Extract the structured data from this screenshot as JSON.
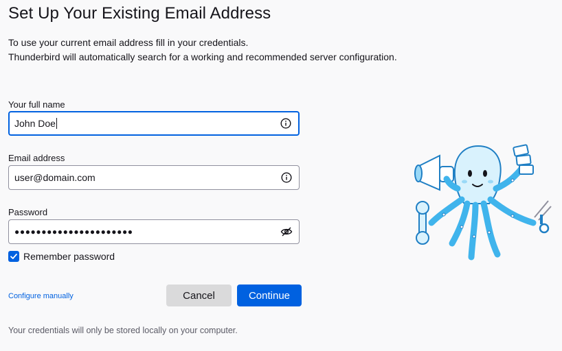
{
  "header": {
    "title": "Set Up Your Existing Email Address",
    "description_line1": "To use your current email address fill in your credentials.",
    "description_line2": "Thunderbird will automatically search for a working and recommended server configuration."
  },
  "form": {
    "full_name": {
      "label": "Your full name",
      "value": "John Doe",
      "icon": "info-icon"
    },
    "email": {
      "label": "Email address",
      "value": "user@domain.com",
      "icon": "info-icon"
    },
    "password": {
      "label": "Password",
      "masked_value": "●●●●●●●●●●●●●●●●●●●●●●",
      "icon": "eye-slash-icon"
    },
    "remember_password": {
      "label": "Remember password",
      "checked": true
    }
  },
  "actions": {
    "configure_manually": "Configure manually",
    "cancel": "Cancel",
    "continue": "Continue"
  },
  "footer": {
    "note": "Your credentials will only be stored locally on your computer."
  },
  "colors": {
    "accent": "#0061e0",
    "mascot": "#40b4ec"
  }
}
